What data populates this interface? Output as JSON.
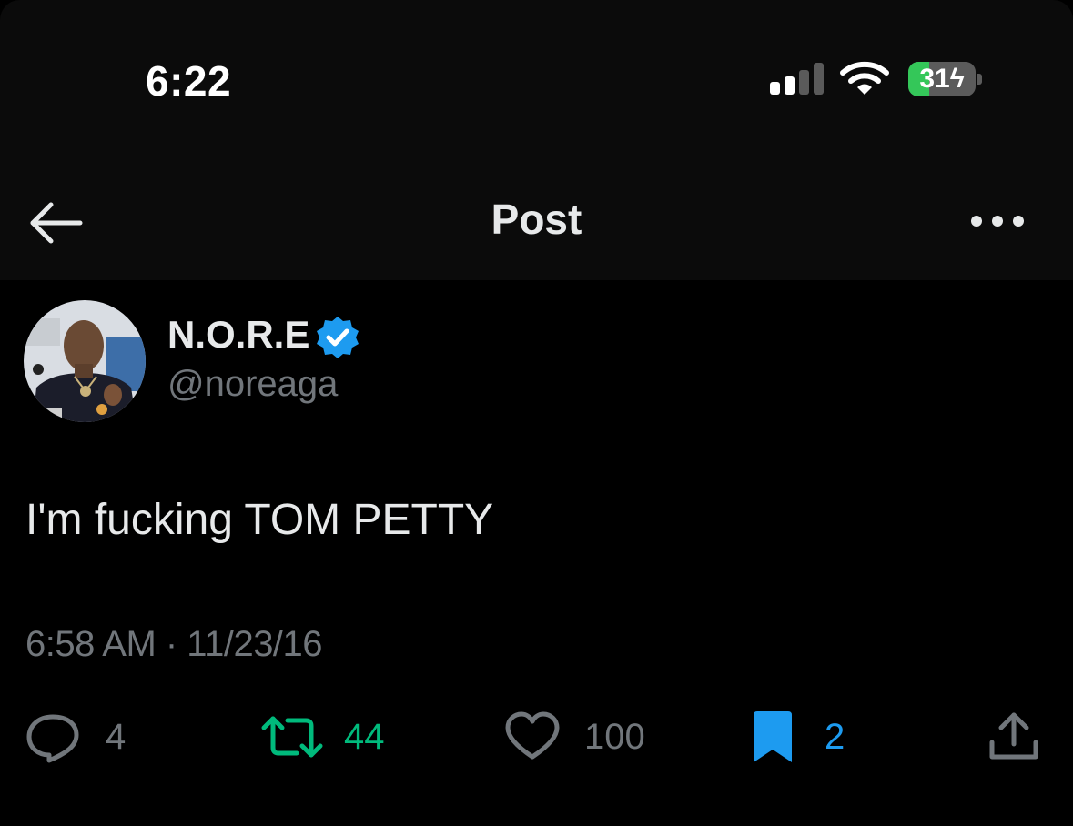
{
  "status_bar": {
    "time": "6:22",
    "battery_level": "31",
    "battery_fraction": 0.31,
    "signal_bars_active": 2,
    "signal_bars_total": 4,
    "battery_color": "#34c759",
    "icons": [
      "cellular-signal-icon",
      "wifi-icon",
      "battery-charging-icon"
    ]
  },
  "header": {
    "title": "Post",
    "back_icon": "arrow-left-icon",
    "more_icon": "more-horizontal-icon"
  },
  "post": {
    "author": {
      "name": "N.O.R.E",
      "handle": "@noreaga",
      "verified": true,
      "verified_color": "#1d9bf0"
    },
    "text": "I'm fucking TOM PETTY",
    "timestamp": "6:58 AM · 11/23/16",
    "actions": {
      "replies": {
        "count": "4",
        "icon": "reply-icon",
        "color": "#71767b"
      },
      "reposts": {
        "count": "44",
        "icon": "repost-icon",
        "color": "#00ba7c"
      },
      "likes": {
        "count": "100",
        "icon": "heart-icon",
        "color": "#71767b"
      },
      "bookmarks": {
        "count": "2",
        "icon": "bookmark-icon",
        "color": "#1d9bf0"
      },
      "share": {
        "icon": "share-icon"
      }
    }
  }
}
